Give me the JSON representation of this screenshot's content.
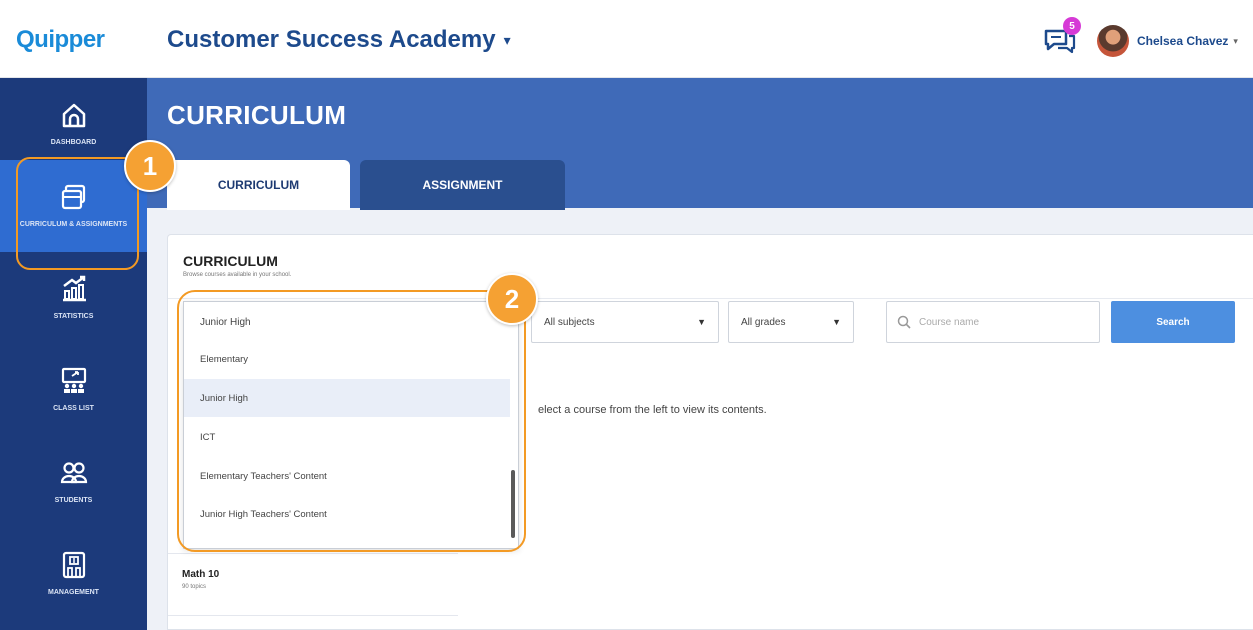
{
  "header": {
    "logo": "Quipper",
    "app_title": "Customer Success Academy",
    "caret": "▾",
    "notification_count": "5",
    "user_name": "Chelsea Chavez",
    "user_caret": "▾"
  },
  "sidebar": {
    "items": [
      {
        "label": "DASHBOARD",
        "icon": "home-icon"
      },
      {
        "label": "CURRICULUM & ASSIGNMENTS",
        "icon": "curriculum-icon"
      },
      {
        "label": "STATISTICS",
        "icon": "statistics-icon"
      },
      {
        "label": "CLASS LIST",
        "icon": "class-list-icon"
      },
      {
        "label": "STUDENTS",
        "icon": "students-icon"
      },
      {
        "label": "MANAGEMENT",
        "icon": "management-icon"
      }
    ]
  },
  "page": {
    "title": "CURRICULUM",
    "tabs": [
      {
        "label": "CURRICULUM"
      },
      {
        "label": "ASSIGNMENT"
      }
    ]
  },
  "card": {
    "title": "CURRICULUM",
    "subtitle": "Browse courses available in your school."
  },
  "filters": {
    "level_selected": "Junior High",
    "subject": "All subjects",
    "grade": "All grades",
    "arrow": "▼",
    "search_placeholder": "Course name",
    "search_button": "Search"
  },
  "dropdown": {
    "options": [
      {
        "label": "Elementary"
      },
      {
        "label": "Junior High"
      },
      {
        "label": "ICT"
      },
      {
        "label": "Elementary Teachers' Content"
      },
      {
        "label": "Junior High Teachers' Content"
      }
    ]
  },
  "content": {
    "hint": "elect a course from the left to view its contents."
  },
  "courses": [
    {
      "name": "Math 10",
      "topics": "90 topics"
    }
  ],
  "callouts": {
    "step1": "1",
    "step2": "2"
  },
  "colors": {
    "sidebar": "#1c3a7b",
    "sidebar_active": "#2f6cd1",
    "hero": "#3f6ab8",
    "accent_orange": "#f5a133",
    "search_button": "#4d8fe0"
  }
}
